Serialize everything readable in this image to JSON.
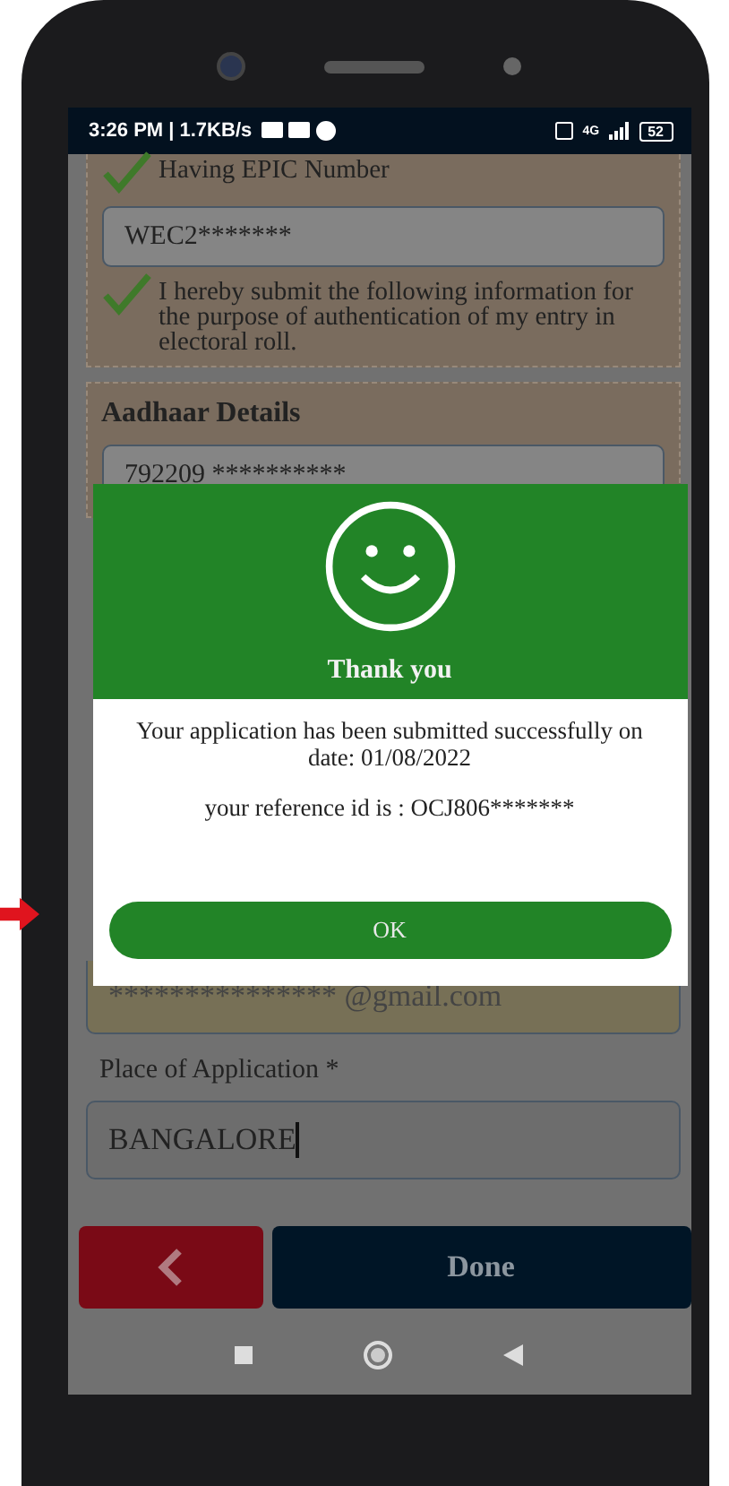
{
  "status_bar": {
    "time": "3:26 PM | 1.7KB/s",
    "network": "4G",
    "battery": "52"
  },
  "epic": {
    "has_epic": {
      "label": "Having EPIC Number",
      "checked": true
    },
    "epic_value": "WEC2*******",
    "consent": {
      "label": "I hereby submit the following information for the purpose of authentication of my entry in electoral roll.",
      "checked": true
    }
  },
  "aadhaar": {
    "title": "Aadhaar Details",
    "value": "792209 **********"
  },
  "email_value": "*************** @gmail.com",
  "place": {
    "label": "Place of Application *",
    "value": "BANGALORE"
  },
  "done_button": "Done",
  "dialog": {
    "title": "Thank you",
    "message": "Your application has been submitted successfully on date: 01/08/2022",
    "reference": "your reference id is : OCJ806*******",
    "ok": "OK"
  }
}
